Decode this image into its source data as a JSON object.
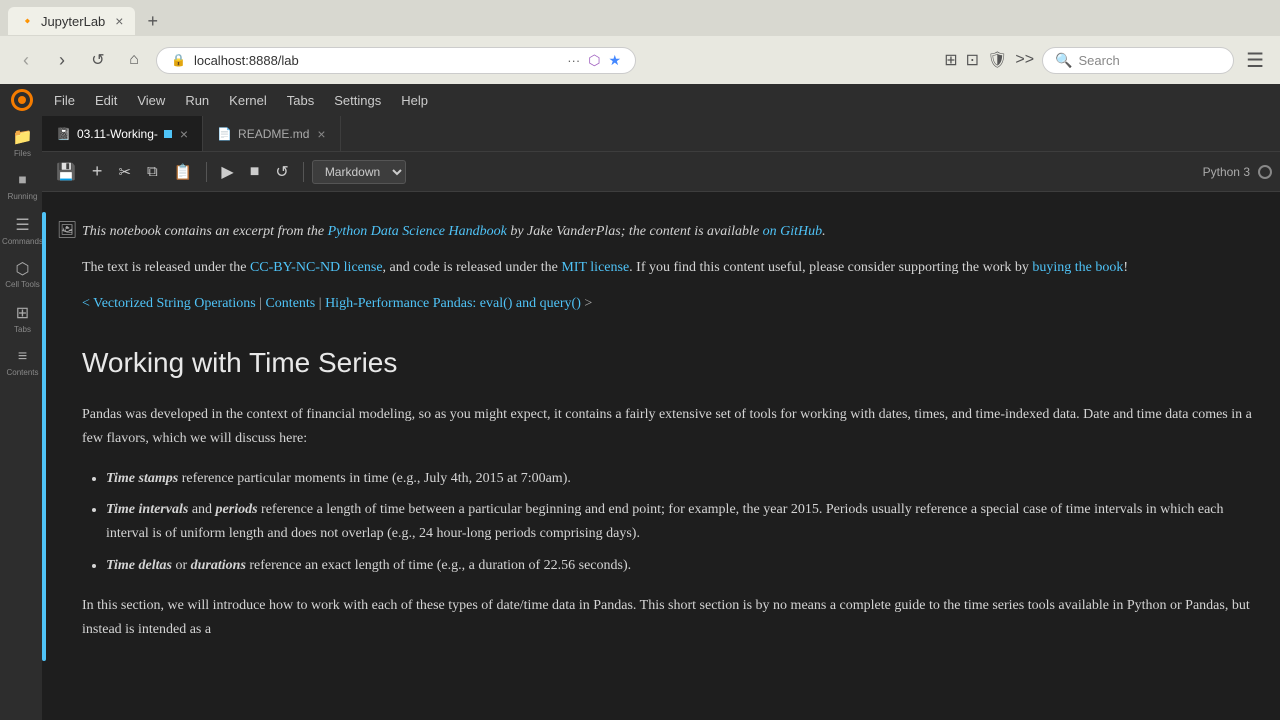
{
  "browser": {
    "tab": {
      "title": "JupyterLab",
      "favicon": "🔸"
    },
    "address": "localhost:8888/lab",
    "search_placeholder": "Search",
    "new_tab_label": "+"
  },
  "menu": {
    "logo": "○",
    "items": [
      "File",
      "Edit",
      "View",
      "Run",
      "Kernel",
      "Tabs",
      "Settings",
      "Help"
    ]
  },
  "sidebar": {
    "icons": [
      {
        "name": "files",
        "label": "Files",
        "symbol": "📁"
      },
      {
        "name": "running",
        "label": "Running",
        "symbol": "⏹"
      },
      {
        "name": "commands",
        "label": "Commands",
        "symbol": "☰"
      },
      {
        "name": "cell-tools",
        "label": "Cell Tools",
        "symbol": "🔧"
      },
      {
        "name": "tabs",
        "label": "Tabs",
        "symbol": "⊞"
      },
      {
        "name": "contents",
        "label": "Contents",
        "symbol": "☰"
      }
    ]
  },
  "tabs": [
    {
      "id": "notebook",
      "label": "03.11-Working-",
      "icon": "📓",
      "has_dot": true,
      "active": true
    },
    {
      "id": "readme",
      "label": "README.md",
      "icon": "📄",
      "has_dot": false,
      "active": false
    }
  ],
  "toolbar": {
    "save": "💾",
    "add_cell": "+",
    "cut": "✂",
    "copy": "⧉",
    "paste": "📋",
    "run": "▶",
    "stop": "■",
    "restart": "↺",
    "cell_type": "Markdown",
    "kernel_name": "Python 3"
  },
  "notebook": {
    "excerpt_text": "This notebook contains an excerpt from the ",
    "book_link": "Python Data Science Handbook",
    "author_text": " by Jake VanderPlas; the content is available ",
    "github_link": "on GitHub",
    "github_suffix": ".",
    "license_text_1": "The text is released under the ",
    "license_link_1": "CC-BY-NC-ND license",
    "license_text_2": ", and code is released under the ",
    "license_link_2": "MIT license",
    "license_text_3": ". If you find this content useful, please consider supporting the work by ",
    "buying_link": "buying the book",
    "buying_suffix": "!",
    "nav_prev": "< Vectorized String Operations",
    "nav_sep1": "|",
    "nav_contents": "Contents",
    "nav_sep2": "|",
    "nav_next": "High-Performance Pandas: eval() and query()",
    "nav_next_arrow": ">",
    "heading": "Working with Time Series",
    "intro_para": "Pandas was developed in the context of financial modeling, so as you might expect, it contains a fairly extensive set of tools for working with dates, times, and time-indexed data. Date and time data comes in a few flavors, which we will discuss here:",
    "bullets": [
      {
        "term": "Time stamps",
        "text": " reference particular moments in time (e.g., July 4th, 2015 at 7:00am)."
      },
      {
        "term": "Time intervals",
        "term2": "periods",
        "text": " reference a length of time between a particular beginning and end point; for example, the year 2015. Periods usually reference a special case of time intervals in which each interval is of uniform length and does not overlap (e.g., 24 hour-long periods comprising days)."
      },
      {
        "term": "Time deltas",
        "term2": "durations",
        "text": " reference an exact length of time (e.g., a duration of 22.56 seconds)."
      }
    ],
    "last_para": "In this section, we will introduce how to work with each of these types of date/time data in Pandas. This short section is by no means a complete guide to the time series tools available in Python or Pandas, but instead is intended as a"
  }
}
